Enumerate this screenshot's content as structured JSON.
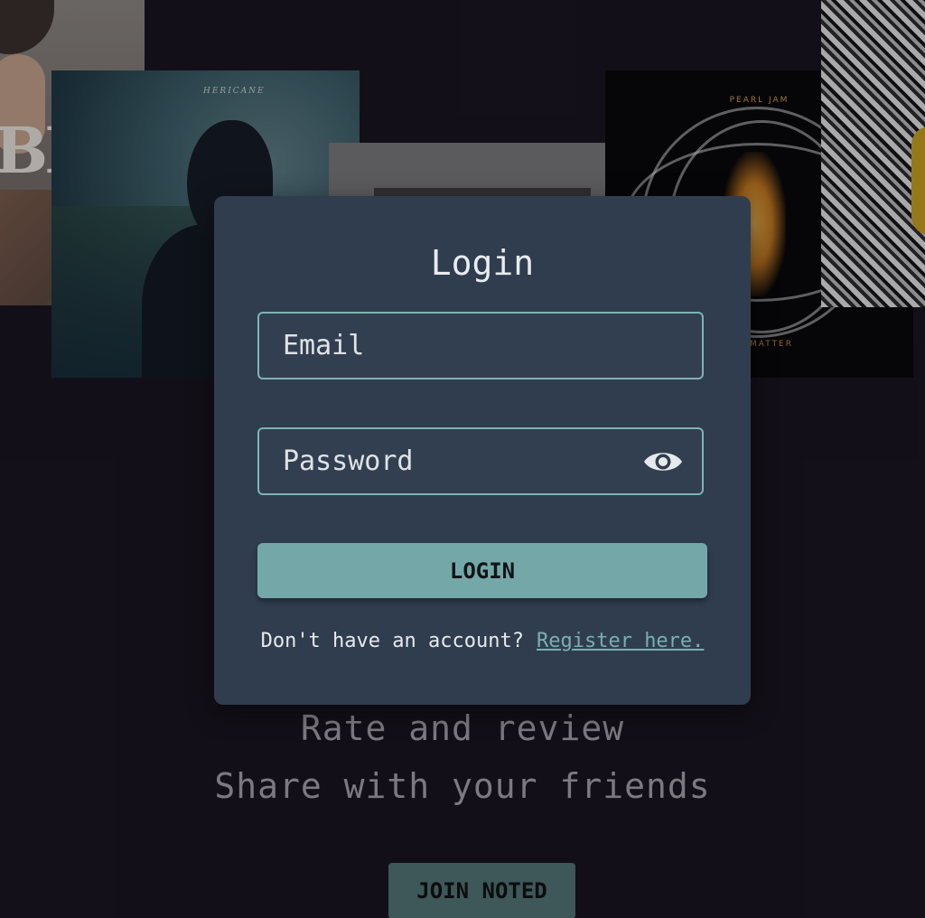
{
  "background": {
    "albums": [
      {
        "name": "album-cover-left-cowboy",
        "text": "BE"
      },
      {
        "name": "album-cover-hericane",
        "text": "HERICANE"
      },
      {
        "name": "album-cover-grey",
        "text": ""
      },
      {
        "name": "album-cover-pearl-jam",
        "artist": "PEARL JAM",
        "title": "MATTER"
      },
      {
        "name": "album-cover-graffiti",
        "text": ""
      }
    ]
  },
  "modal": {
    "title": "Login",
    "email_placeholder": "Email",
    "password_placeholder": "Password",
    "password_toggle_icon": "eye-icon",
    "login_label": "LOGIN",
    "register_prompt": "Don't have an account?",
    "register_link": "Register here."
  },
  "taglines": [
    "Rate and review",
    "Share with your friends"
  ],
  "join_label": "JOIN NOTED",
  "colors": {
    "page_bg": "#17131d",
    "modal_bg": "#303d4f",
    "accent": "#74a8a8",
    "field_border": "#7fb3b2",
    "link": "#78b0b0",
    "tagline": "#7b7a80"
  }
}
